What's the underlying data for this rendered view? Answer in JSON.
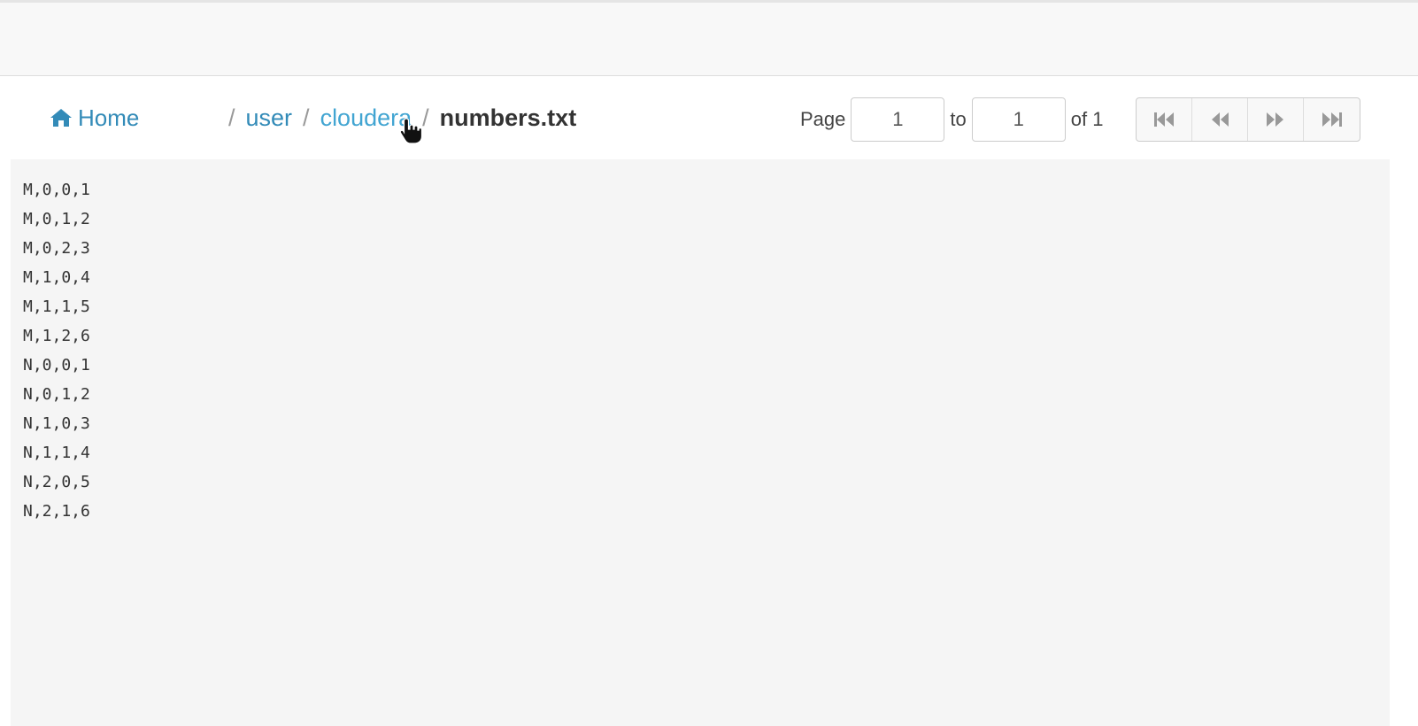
{
  "breadcrumb": {
    "home_label": "Home",
    "separator": "/",
    "items": [
      {
        "label": "user"
      },
      {
        "label": "cloudera"
      }
    ],
    "current": "numbers.txt"
  },
  "pager": {
    "page_label": "Page",
    "from_value": "1",
    "to_label": "to",
    "to_value": "1",
    "of_label": "of 1",
    "buttons": [
      "first-page",
      "previous-page",
      "next-page",
      "last-page"
    ]
  },
  "file": {
    "lines": [
      "M,0,0,1",
      "M,0,1,2",
      "M,0,2,3",
      "M,1,0,4",
      "M,1,1,5",
      "M,1,2,6",
      "N,0,0,1",
      "N,0,1,2",
      "N,1,0,3",
      "N,1,1,4",
      "N,2,0,5",
      "N,2,1,6"
    ]
  },
  "colors": {
    "link": "#338bb8",
    "text": "#333333",
    "content_bg": "#f5f5f5"
  }
}
